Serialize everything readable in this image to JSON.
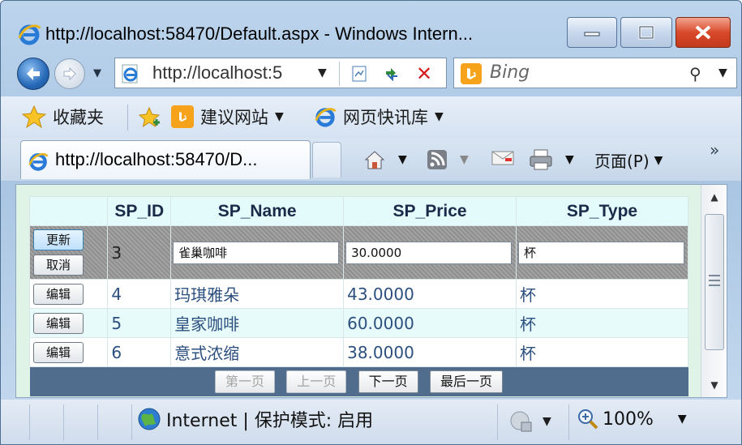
{
  "window": {
    "title": "http://localhost:58470/Default.aspx - Windows Intern..."
  },
  "address_bar": {
    "url": "http://localhost:5"
  },
  "search": {
    "placeholder": "Bing"
  },
  "favorites_bar": {
    "favorites_label": "收藏夹",
    "items": [
      {
        "label": "建议网站",
        "icon": "bing-icon"
      },
      {
        "label": "网页快讯库",
        "icon": "ie-icon"
      }
    ]
  },
  "tab": {
    "title": "http://localhost:58470/D..."
  },
  "command_bar": {
    "page_label": "页面(P)",
    "chevron": "»"
  },
  "grid": {
    "columns": [
      "",
      "SP_ID",
      "SP_Name",
      "SP_Price",
      "SP_Type"
    ],
    "edit_row": {
      "update_label": "更新",
      "cancel_label": "取消",
      "id": "3",
      "name": "雀巢咖啡",
      "price": "30.0000",
      "type": "杯"
    },
    "rows": [
      {
        "edit_label": "编辑",
        "id": "4",
        "name": "玛琪雅朵",
        "price": "43.0000",
        "type": "杯"
      },
      {
        "edit_label": "编辑",
        "id": "5",
        "name": "皇家咖啡",
        "price": "60.0000",
        "type": "杯"
      },
      {
        "edit_label": "编辑",
        "id": "6",
        "name": "意式浓缩",
        "price": "38.0000",
        "type": "杯"
      }
    ],
    "pager": {
      "first": "第一页",
      "prev": "上一页",
      "next": "下一页",
      "last": "最后一页"
    }
  },
  "status_bar": {
    "zone": "Internet | 保护模式: 启用",
    "zoom": "100%"
  },
  "colors": {
    "accent": "#2b4f7e",
    "pager_bg": "#506d8e",
    "header_bg": "#e4fbfb"
  }
}
